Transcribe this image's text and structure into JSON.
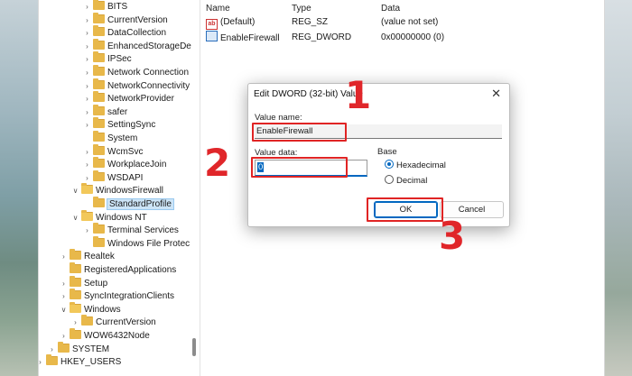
{
  "tree": {
    "items": [
      {
        "label": "BITS",
        "indent": 3,
        "chevron": true
      },
      {
        "label": "CurrentVersion",
        "indent": 3,
        "chevron": true
      },
      {
        "label": "DataCollection",
        "indent": 3,
        "chevron": true
      },
      {
        "label": "EnhancedStorageDe",
        "indent": 3,
        "chevron": true
      },
      {
        "label": "IPSec",
        "indent": 3,
        "chevron": true
      },
      {
        "label": "Network Connection",
        "indent": 3,
        "chevron": true
      },
      {
        "label": "NetworkConnectivity",
        "indent": 3,
        "chevron": true
      },
      {
        "label": "NetworkProvider",
        "indent": 3,
        "chevron": true
      },
      {
        "label": "safer",
        "indent": 3,
        "chevron": true
      },
      {
        "label": "SettingSync",
        "indent": 3,
        "chevron": true
      },
      {
        "label": "System",
        "indent": 3,
        "chevron": false
      },
      {
        "label": "WcmSvc",
        "indent": 3,
        "chevron": true
      },
      {
        "label": "WorkplaceJoin",
        "indent": 3,
        "chevron": true
      },
      {
        "label": "WSDAPI",
        "indent": 3,
        "chevron": true
      },
      {
        "label": "WindowsFirewall",
        "indent": 2,
        "chevron": "open"
      },
      {
        "label": "StandardProfile",
        "indent": 3,
        "chevron": false,
        "selected": true
      },
      {
        "label": "Windows NT",
        "indent": 2,
        "chevron": "open"
      },
      {
        "label": "Terminal Services",
        "indent": 3,
        "chevron": true
      },
      {
        "label": "Windows File Protec",
        "indent": 3,
        "chevron": false
      },
      {
        "label": "Realtek",
        "indent": 1,
        "chevron": true
      },
      {
        "label": "RegisteredApplications",
        "indent": 1,
        "chevron": false
      },
      {
        "label": "Setup",
        "indent": 1,
        "chevron": true
      },
      {
        "label": "SyncIntegrationClients",
        "indent": 1,
        "chevron": true
      },
      {
        "label": "Windows",
        "indent": 1,
        "chevron": "open"
      },
      {
        "label": "CurrentVersion",
        "indent": 2,
        "chevron": true
      },
      {
        "label": "WOW6432Node",
        "indent": 1,
        "chevron": true
      },
      {
        "label": "SYSTEM",
        "indent": 0,
        "chevron": true
      },
      {
        "label": "HKEY_USERS",
        "indent": -1,
        "chevron": true
      }
    ]
  },
  "values": {
    "headers": {
      "name": "Name",
      "type": "Type",
      "data": "Data"
    },
    "rows": [
      {
        "icon": "string-value-icon",
        "name": "(Default)",
        "type": "REG_SZ",
        "data": "(value not set)"
      },
      {
        "icon": "binary-value-icon",
        "name": "EnableFirewall",
        "type": "REG_DWORD",
        "data": "0x00000000 (0)"
      }
    ]
  },
  "dialog": {
    "title": "Edit DWORD (32-bit) Value",
    "value_name_label": "Value name:",
    "value_name": "EnableFirewall",
    "value_data_label": "Value data:",
    "value_data": "0",
    "base_label": "Base",
    "radio_hex": "Hexadecimal",
    "radio_dec": "Decimal",
    "base_selected": "Hexadecimal",
    "ok_label": "OK",
    "cancel_label": "Cancel",
    "close_glyph": "✕"
  },
  "annotations": {
    "step1": "1",
    "step2": "2",
    "step3": "3",
    "color": "#e0262a"
  }
}
